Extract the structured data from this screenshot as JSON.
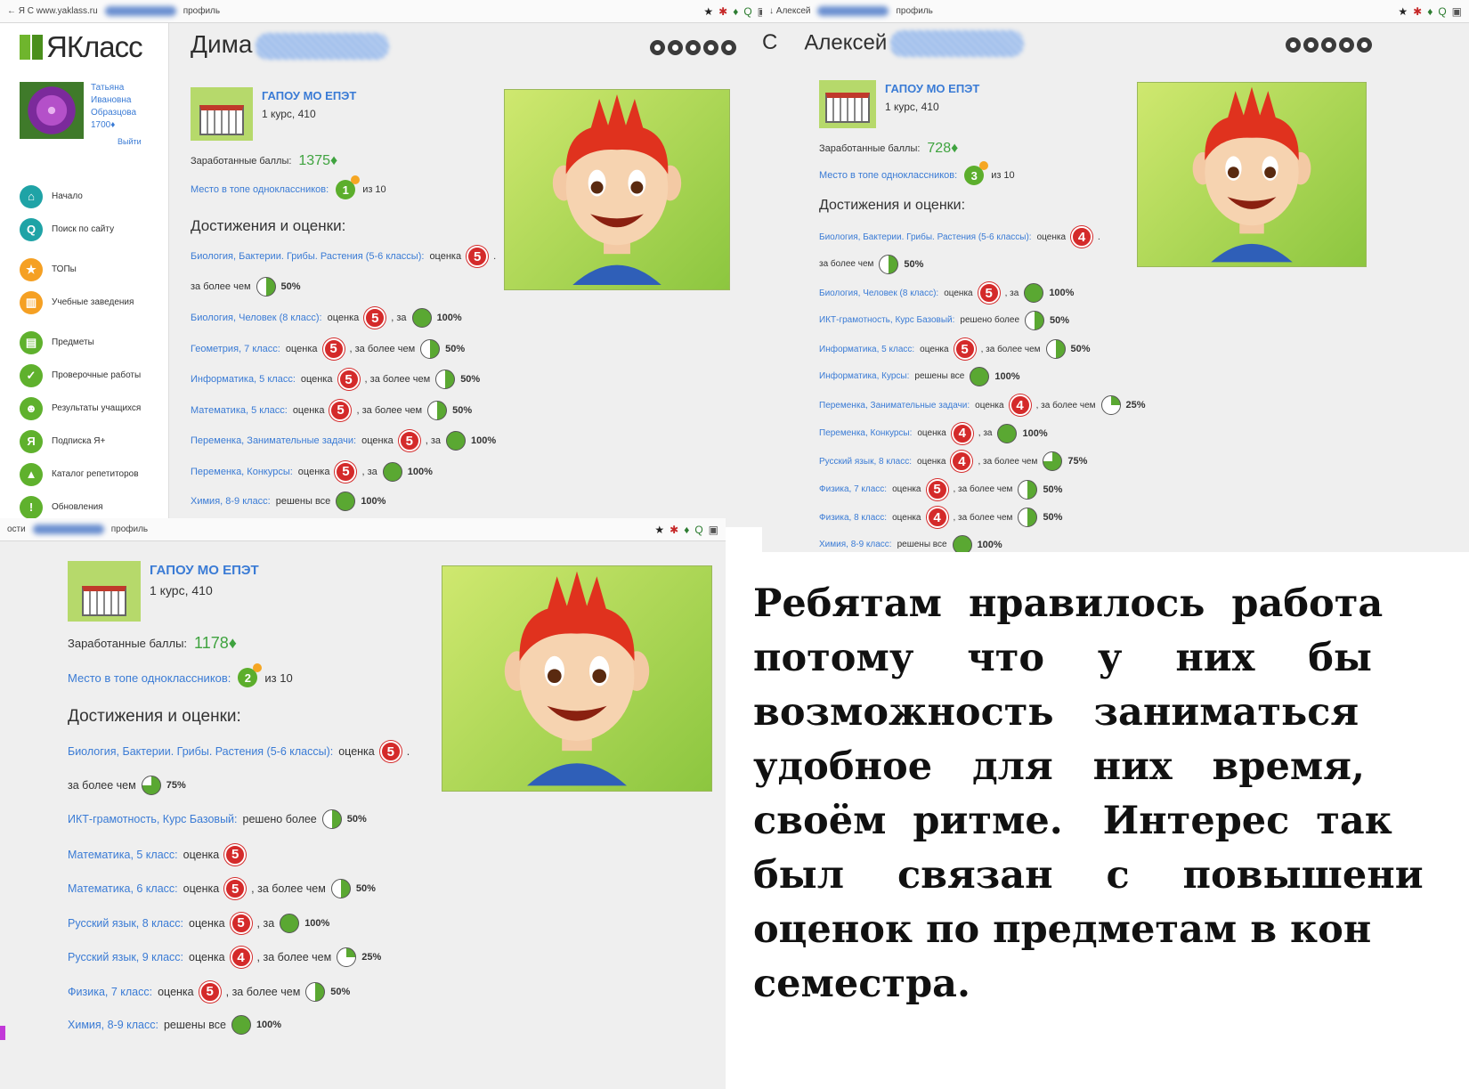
{
  "s1": {
    "bar_left": "← Я  C  www.yaklass.ru",
    "bar_tab": "профиль",
    "logo": "ЯКласс",
    "user_name": "Татьяна Ивановна Образцова",
    "user_points": "1700♦",
    "user_exit": "Выйти",
    "nav": [
      {
        "label": "Начало",
        "icon": "home-icon",
        "color": "teal",
        "glyph": "⌂"
      },
      {
        "label": "Поиск по сайту",
        "icon": "search-icon",
        "color": "teal",
        "glyph": "Q"
      },
      {
        "label": "ТОПы",
        "icon": "star-icon",
        "color": "orange",
        "glyph": "★"
      },
      {
        "label": "Учебные заведения",
        "icon": "building-icon",
        "color": "orange",
        "glyph": "▥"
      },
      {
        "label": "Предметы",
        "icon": "book-icon",
        "color": "green",
        "glyph": "▤"
      },
      {
        "label": "Проверочные работы",
        "icon": "check-icon",
        "color": "green",
        "glyph": "✓"
      },
      {
        "label": "Результаты учащихся",
        "icon": "users-icon",
        "color": "green",
        "glyph": "☻"
      },
      {
        "label": "Подписка Я+",
        "icon": "ya-plus-icon",
        "color": "green",
        "glyph": "Я"
      },
      {
        "label": "Каталог репетиторов",
        "icon": "cap-icon",
        "color": "green",
        "glyph": "▲"
      },
      {
        "label": "Обновления",
        "icon": "info-icon",
        "color": "green",
        "glyph": "!"
      }
    ],
    "name": "Дима",
    "school": "ГАПОУ МО ЕПЭТ",
    "course": "1 курс, 410",
    "points_label": "Заработанные баллы:",
    "points": "1375♦",
    "rank_label": "Место в топе одноклассников:",
    "rank": "1",
    "rank_of": "из 10",
    "ach_title": "Достижения и оценки:",
    "rows": [
      {
        "subj": "Биология, Бактерии. Грибы. Растения (5-6 классы):",
        "mid": "оценка",
        "grade": "5",
        "tail": ".",
        "pct": ""
      },
      {
        "subj": "",
        "mid": "за более чем",
        "grade": "",
        "tail": "",
        "pct": "50%",
        "frac": 0.5
      },
      {
        "subj": "Биология, Человек (8 класс):",
        "mid": "оценка",
        "grade": "5",
        "tail": ", за",
        "pct": "100%",
        "frac": 1
      },
      {
        "subj": "Геометрия, 7 класс:",
        "mid": "оценка",
        "grade": "5",
        "tail": ", за более чем",
        "pct": "50%",
        "frac": 0.5
      },
      {
        "subj": "Информатика, 5 класс:",
        "mid": "оценка",
        "grade": "5",
        "tail": ", за более чем",
        "pct": "50%",
        "frac": 0.5
      },
      {
        "subj": "Математика, 5 класс:",
        "mid": "оценка",
        "grade": "5",
        "tail": ", за более чем",
        "pct": "50%",
        "frac": 0.5
      },
      {
        "subj": "Переменка, Занимательные задачи:",
        "mid": "оценка",
        "grade": "5",
        "tail": ", за",
        "pct": "100%",
        "frac": 1
      },
      {
        "subj": "Переменка, Конкурсы:",
        "mid": "оценка",
        "grade": "5",
        "tail": ", за",
        "pct": "100%",
        "frac": 1
      },
      {
        "subj": "Химия, 8-9 класс:",
        "mid": "решены все",
        "grade": "",
        "tail": "",
        "pct": "100%",
        "frac": 1
      }
    ]
  },
  "s2": {
    "bar_left": "↓ Алексей",
    "bar_tab": "профиль",
    "title_prefix": "С",
    "name": "Алексей",
    "school": "ГАПОУ МО ЕПЭТ",
    "course": "1 курс, 410",
    "points_label": "Заработанные баллы:",
    "points": "728♦",
    "rank_label": "Место в топе одноклассников:",
    "rank": "3",
    "rank_of": "из 10",
    "ach_title": "Достижения и оценки:",
    "rows": [
      {
        "subj": "Биология, Бактерии. Грибы. Растения (5-6 классы):",
        "mid": "оценка",
        "grade": "4",
        "tail": ".",
        "pct": ""
      },
      {
        "subj": "",
        "mid": "за более чем",
        "grade": "",
        "tail": "",
        "pct": "50%",
        "frac": 0.5
      },
      {
        "subj": "Биология, Человек (8 класс):",
        "mid": "оценка",
        "grade": "5",
        "tail": ", за",
        "pct": "100%",
        "frac": 1
      },
      {
        "subj": "ИКТ-грамотность, Курс Базовый:",
        "mid": "решено более",
        "grade": "",
        "tail": "",
        "pct": "50%",
        "frac": 0.5
      },
      {
        "subj": "Информатика, 5 класс:",
        "mid": "оценка",
        "grade": "5",
        "tail": ", за более чем",
        "pct": "50%",
        "frac": 0.5
      },
      {
        "subj": "Информатика, Курсы:",
        "mid": "решены все",
        "grade": "",
        "tail": "",
        "pct": "100%",
        "frac": 1
      },
      {
        "subj": "Переменка, Занимательные задачи:",
        "mid": "оценка",
        "grade": "4",
        "tail": ", за более чем",
        "pct": "25%",
        "frac": 0.25
      },
      {
        "subj": "Переменка, Конкурсы:",
        "mid": "оценка",
        "grade": "4",
        "tail": ", за",
        "pct": "100%",
        "frac": 1
      },
      {
        "subj": "Русский язык, 8 класс:",
        "mid": "оценка",
        "grade": "4",
        "tail": ", за более чем",
        "pct": "75%",
        "frac": 0.75
      },
      {
        "subj": "Физика, 7 класс:",
        "mid": "оценка",
        "grade": "5",
        "tail": ", за более чем",
        "pct": "50%",
        "frac": 0.5
      },
      {
        "subj": "Физика, 8 класс:",
        "mid": "оценка",
        "grade": "4",
        "tail": ", за более чем",
        "pct": "50%",
        "frac": 0.5
      },
      {
        "subj": "Химия, 8-9 класс:",
        "mid": "решены все",
        "grade": "",
        "tail": "",
        "pct": "100%",
        "frac": 1
      }
    ]
  },
  "s3": {
    "bar_left": "ости",
    "bar_tab": "профиль",
    "school": "ГАПОУ МО ЕПЭТ",
    "course": "1 курс, 410",
    "points_label": "Заработанные баллы:",
    "points": "1178♦",
    "rank_label": "Место в топе одноклассников:",
    "rank": "2",
    "rank_of": "из 10",
    "ach_title": "Достижения и оценки:",
    "rows": [
      {
        "subj": "Биология, Бактерии. Грибы. Растения (5-6 классы):",
        "mid": "оценка",
        "grade": "5",
        "tail": ".",
        "pct": ""
      },
      {
        "subj": "",
        "mid": "за более чем",
        "grade": "",
        "tail": "",
        "pct": "75%",
        "frac": 0.75
      },
      {
        "subj": "ИКТ-грамотность, Курс Базовый:",
        "mid": "решено более",
        "grade": "",
        "tail": "",
        "pct": "50%",
        "frac": 0.5
      },
      {
        "subj": "Математика, 5 класс:",
        "mid": "оценка",
        "grade": "5",
        "tail": "",
        "pct": ""
      },
      {
        "subj": "Математика, 6 класс:",
        "mid": "оценка",
        "grade": "5",
        "tail": ", за более чем",
        "pct": "50%",
        "frac": 0.5
      },
      {
        "subj": "Русский язык, 8 класс:",
        "mid": "оценка",
        "grade": "5",
        "tail": ", за",
        "pct": "100%",
        "frac": 1
      },
      {
        "subj": "Русский язык, 9 класс:",
        "mid": "оценка",
        "grade": "4",
        "tail": ", за более чем",
        "pct": "25%",
        "frac": 0.25
      },
      {
        "subj": "Физика, 7 класс:",
        "mid": "оценка",
        "grade": "5",
        "tail": ", за более чем",
        "pct": "50%",
        "frac": 0.5
      },
      {
        "subj": "Химия, 8-9 класс:",
        "mid": "решены все",
        "grade": "",
        "tail": "",
        "pct": "100%",
        "frac": 1
      }
    ]
  },
  "caption_lines": [
    "Ребятам  нравилось  работа",
    "потому    что    у    них    бы",
    "возможность   заниматься",
    "удобное   для   них   время,",
    "своём  ритме.   Интерес  так",
    "был    связан    с    повышени",
    "оценок по предметам в кон",
    "семестра."
  ],
  "colors": {
    "accent_green": "#5fb12d",
    "grade_red": "#d42a2a",
    "link_blue": "#3a7bd5"
  }
}
